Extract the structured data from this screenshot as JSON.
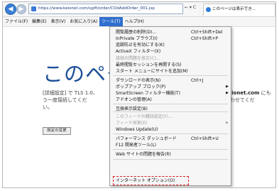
{
  "browser": {
    "url": "https://www.keionet.com/sgift/order/COdAddOrder_001.jsp",
    "addr_tools": "← ▾ C",
    "tab_title": "このページは表示でき..."
  },
  "menubar": [
    {
      "label": "ファイル(F)"
    },
    {
      "label": "編集(E)"
    },
    {
      "label": "表示(V)"
    },
    {
      "label": "お気に入り(A)"
    },
    {
      "label": "ツール(T)",
      "active": true
    },
    {
      "label": "ヘルプ(H)"
    }
  ],
  "page": {
    "headline": "このページ",
    "body_left": "[詳細設定] で TLS 1.0、\nう一度接続してくだ\nい。",
    "body_right_domain": "keionet.com",
    "body_right_tail": " にも",
    "body_right_line2": "合わせてくだ",
    "settings_button": "設定の変更"
  },
  "tools_menu": [
    {
      "label": "閲覧履歴の削除(D)...",
      "shortcut": "Ctrl+Shift+Del"
    },
    {
      "label": "InPrivate ブラウズ(I)",
      "shortcut": "Ctrl+Shift+P"
    },
    {
      "label": "追跡防止を有効にする(K)"
    },
    {
      "label": "ActiveX フィルター(X)"
    },
    {
      "label": "接続の問題を修正(C)...",
      "disabled": true
    },
    {
      "label": "最終閲覧セッションを再開する(S)"
    },
    {
      "label": "スタート メニューにサイトを追加(M)"
    },
    {
      "label": "ダウンロードの表示(N)",
      "shortcut": "Ctrl+J"
    },
    {
      "label": "ポップアップ ブロック(P)",
      "arrow": "▶"
    },
    {
      "label": "SmartScreen フィルター機能(T)",
      "arrow": "▶"
    },
    {
      "label": "アドオンの管理(A)"
    },
    {
      "label": "互換表示設定(B)"
    },
    {
      "label": "このフィードの購読設定(F)...",
      "disabled": true
    },
    {
      "label": "フィード探索(E)",
      "disabled": true,
      "arrow": "▶"
    },
    {
      "label": "Windows Update(U)"
    },
    {
      "label": "パフォーマンス ダッシュボード",
      "shortcut": "Ctrl+Shift+U"
    },
    {
      "label": "F12 開発者ツール(L)"
    },
    {
      "label": "Web サイトの問題を報告(R)"
    },
    {
      "label": "インターネット オプション(O)",
      "highlighted": true
    }
  ],
  "colors": {
    "accent": "#2f6fcf",
    "headline": "#1b4f96",
    "highlight_box": "#d81b1b"
  }
}
